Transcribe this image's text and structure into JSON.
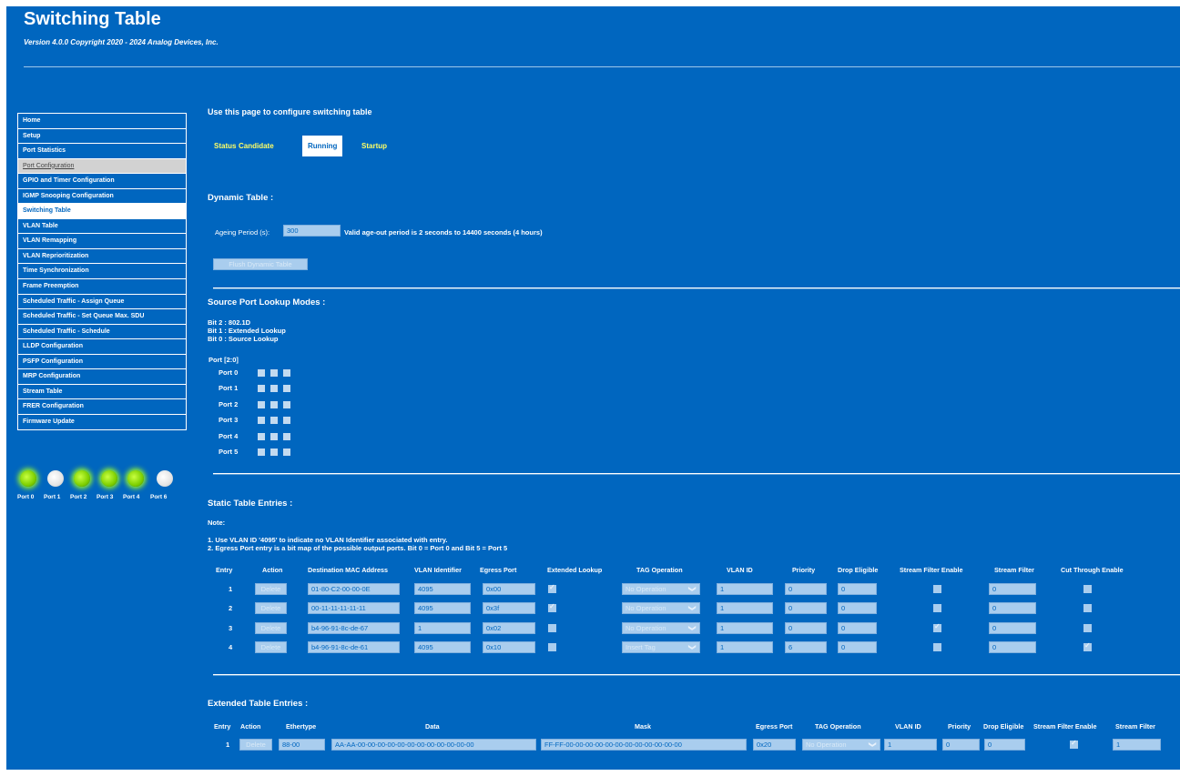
{
  "header": {
    "title": "Switching Table",
    "version": "Version 4.0.0 Copyright 2020 - 2024 Analog Devices, Inc."
  },
  "nav": {
    "items": [
      {
        "label": "Home",
        "state": "normal"
      },
      {
        "label": "Setup",
        "state": "normal"
      },
      {
        "label": "Port Statistics",
        "state": "normal"
      },
      {
        "label": "Port Configuration",
        "state": "disabled"
      },
      {
        "label": "GPIO and Timer Configuration",
        "state": "normal"
      },
      {
        "label": "IGMP Snooping Configuration",
        "state": "normal"
      },
      {
        "label": "Switching Table",
        "state": "active"
      },
      {
        "label": "VLAN Table",
        "state": "normal"
      },
      {
        "label": "VLAN Remapping",
        "state": "normal"
      },
      {
        "label": "VLAN Reprioritization",
        "state": "normal"
      },
      {
        "label": "Time Synchronization",
        "state": "normal"
      },
      {
        "label": "Frame Preemption",
        "state": "normal"
      },
      {
        "label": "Scheduled Traffic - Assign Queue",
        "state": "normal"
      },
      {
        "label": "Scheduled Traffic - Set Queue Max. SDU",
        "state": "normal"
      },
      {
        "label": "Scheduled Traffic - Schedule",
        "state": "normal"
      },
      {
        "label": "LLDP Configuration",
        "state": "normal"
      },
      {
        "label": "PSFP Configuration",
        "state": "normal"
      },
      {
        "label": "MRP Configuration",
        "state": "normal"
      },
      {
        "label": "Stream Table",
        "state": "normal"
      },
      {
        "label": "FRER Configuration",
        "state": "normal"
      },
      {
        "label": "Firmware Update",
        "state": "normal"
      }
    ]
  },
  "ports_status": [
    {
      "label": "Port 0",
      "state": "on"
    },
    {
      "label": "Port 1",
      "state": "off"
    },
    {
      "label": "Port 2",
      "state": "on"
    },
    {
      "label": "Port 3",
      "state": "on"
    },
    {
      "label": "Port 4",
      "state": "on"
    },
    {
      "label": "Port 6",
      "state": "off"
    }
  ],
  "main": {
    "intro": "Use this page to configure switching table",
    "tabs": [
      {
        "label": "Status",
        "active": false
      },
      {
        "label": "Candidate",
        "active": false
      },
      {
        "label": "Running",
        "active": true
      },
      {
        "label": "Startup",
        "active": false
      }
    ]
  },
  "dynamic": {
    "title": "Dynamic Table :",
    "ageing_label": "Ageing Period (s):",
    "ageing_value": "300",
    "ageing_hint": "Valid age-out period is 2 seconds to 14400 seconds (4 hours)",
    "flush_button": "Flush Dynamic Table"
  },
  "lookup": {
    "title": "Source Port Lookup Modes :",
    "bits": [
      "Bit 2 : 802.1D",
      "Bit 1 : Extended Lookup",
      "Bit 0 : Source Lookup"
    ],
    "port_header": "Port [2:0]",
    "ports": [
      "Port 0",
      "Port 1",
      "Port 2",
      "Port 3",
      "Port 4",
      "Port 5"
    ]
  },
  "static_table": {
    "title": "Static Table Entries :",
    "note_label": "Note:",
    "notes": [
      "1. Use VLAN ID '4095' to indicate no VLAN Identifier associated with entry.",
      "2. Egress Port entry is a bit map of the possible output ports. Bit 0 = Port 0 and Bit 5 = Port 5"
    ],
    "columns": [
      "Entry",
      "Action",
      "Destination MAC Address",
      "VLAN Identifier",
      "Egress Port",
      "Extended Lookup",
      "TAG Operation",
      "VLAN ID",
      "Priority",
      "Drop Eligible",
      "Stream Filter Enable",
      "Stream Filter",
      "Cut Through Enable"
    ],
    "rows": [
      {
        "entry": "1",
        "action": "Delete",
        "mac": "01-80-C2-00-00-0E",
        "vlan_identifier": "4095",
        "egress": "0x00",
        "extended_lookup": true,
        "tag_op": "No Operation",
        "vlan_id": "1",
        "priority": "0",
        "drop_eligible": "0",
        "sf_enable": false,
        "stream_filter": "0",
        "cut_through": false
      },
      {
        "entry": "2",
        "action": "Delete",
        "mac": "00-11-11-11-11-11",
        "vlan_identifier": "4095",
        "egress": "0x3f",
        "extended_lookup": true,
        "tag_op": "No Operation",
        "vlan_id": "1",
        "priority": "0",
        "drop_eligible": "0",
        "sf_enable": false,
        "stream_filter": "0",
        "cut_through": false
      },
      {
        "entry": "3",
        "action": "Delete",
        "mac": "b4-96-91-8c-de-67",
        "vlan_identifier": "1",
        "egress": "0x02",
        "extended_lookup": false,
        "tag_op": "No Operation",
        "vlan_id": "1",
        "priority": "0",
        "drop_eligible": "0",
        "sf_enable": true,
        "stream_filter": "0",
        "cut_through": false
      },
      {
        "entry": "4",
        "action": "Delete",
        "mac": "b4-96-91-8c-de-61",
        "vlan_identifier": "4095",
        "egress": "0x10",
        "extended_lookup": false,
        "tag_op": "Insert Tag",
        "vlan_id": "1",
        "priority": "6",
        "drop_eligible": "0",
        "sf_enable": false,
        "stream_filter": "0",
        "cut_through": true
      }
    ]
  },
  "extended_table": {
    "title": "Extended Table Entries :",
    "columns": [
      "Entry",
      "Action",
      "Ethertype",
      "Data",
      "Mask",
      "Egress Port",
      "TAG Operation",
      "VLAN ID",
      "Priority",
      "Drop Eligible",
      "Stream Filter Enable",
      "Stream Filter"
    ],
    "rows": [
      {
        "entry": "1",
        "action": "Delete",
        "ethertype": "88-00",
        "data": "AA-AA-00-00-00-00-00-00-00-00-00-00-00-00",
        "mask": "FF-FF-00-00-00-00-00-00-00-00-00-00-00-00",
        "egress": "0x20",
        "tag_op": "No Operation",
        "vlan_id": "1",
        "priority": "0",
        "drop_eligible": "0",
        "sf_enable": true,
        "stream_filter": "1"
      }
    ]
  }
}
